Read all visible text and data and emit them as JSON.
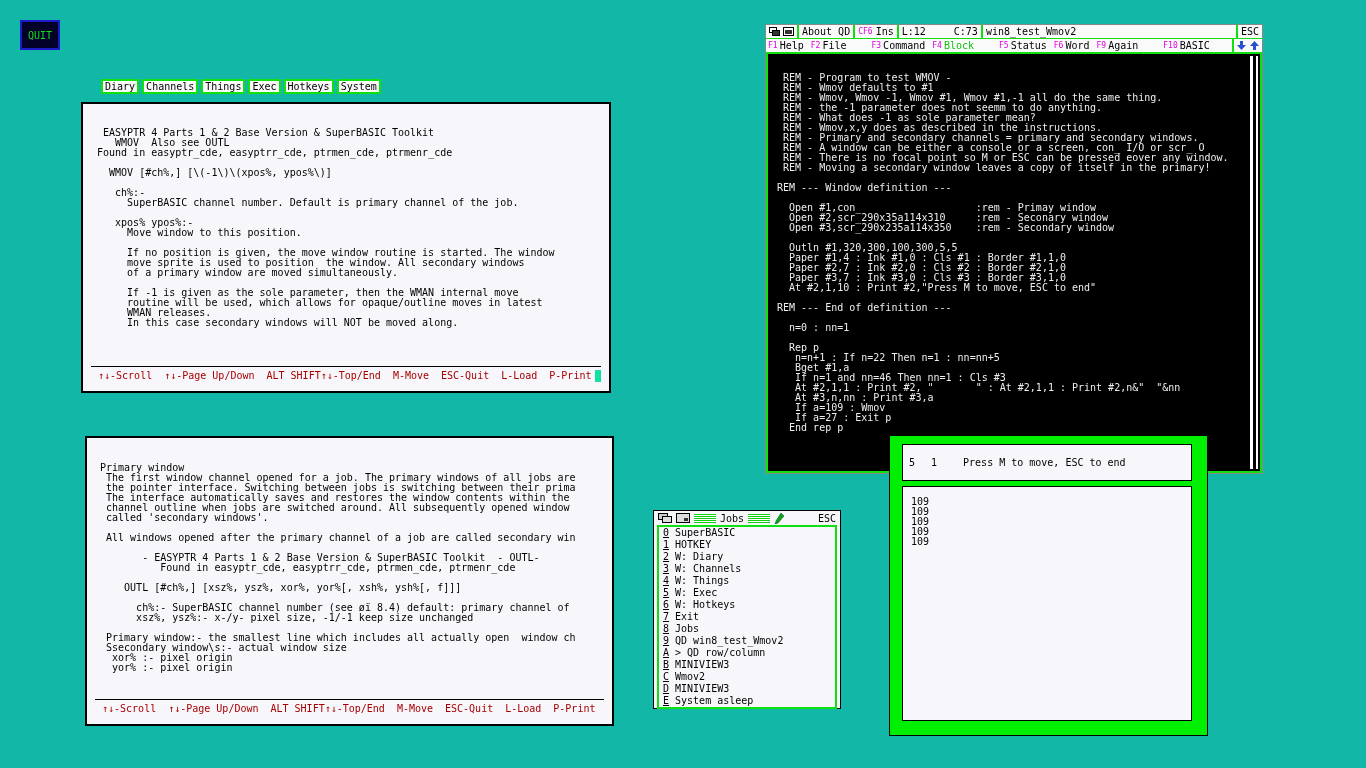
{
  "quit_button": {
    "label": "QUIT"
  },
  "menu": [
    "Diary",
    "Channels",
    "Things",
    "Exec",
    "Hotkeys",
    "System"
  ],
  "help_windows": [
    {
      "cursor": true,
      "blocks": [
        [
          " EASYPTR 4 Parts 1 & 2 Base Version & SuperBASIC Toolkit",
          "   WMOV  Also see OUTL",
          "Found in easyptr_cde, easyptrr_cde, ptrmen_cde, ptrmenr_cde"
        ],
        [
          "  WMOV [#ch%,] [\\(-1\\)\\(xpos%, ypos%\\)]"
        ],
        [
          "   ch%:-",
          "     SuperBASIC channel number. Default is primary channel of the job."
        ],
        [
          "   xpos% ypos%:-",
          "     Move window to this position."
        ],
        [
          "     If no position is given, the move window routine is started. The window",
          "     move sprite is used to position  the window. All secondary windows",
          "     of a primary window are moved simultaneously."
        ],
        [
          "     If -1 is given as the sole parameter, then the WMAN internal move",
          "     routine will be used, which allows for opaque/outline moves in latest",
          "     WMAN releases.",
          "     In this case secondary windows will NOT be moved along."
        ]
      ],
      "footer": [
        "↑↓-Scroll",
        "↑↓-Page Up/Down",
        "ALT SHIFT↑↓-Top/End",
        "M-Move",
        "ESC-Quit",
        "L-Load",
        "P-Print"
      ]
    },
    {
      "cursor": false,
      "blocks": [
        [
          "Primary window",
          " The first window channel opened for a job. The primary windows of all jobs are",
          " the pointer interface. Switching between jobs is switching between their prima",
          " The interface automatically saves and restores the window contents within the",
          " channel outline when jobs are switched around. All subsequently opened window",
          " called 'secondary windows'."
        ],
        [
          " All windows opened after the primary channel of a job are called secondary win"
        ],
        [
          "       - EASYPTR 4 Parts 1 & 2 Base Version & SuperBASIC Toolkit  - OUTL-",
          "          Found in easyptr_cde, easyptrr_cde, ptrmen_cde, ptrmenr_cde"
        ],
        [
          "    OUTL [#ch%,] [xsz%, ysz%, xor%, yor%[, xsh%, ysh%[, f]]]"
        ],
        [
          "      ch%:- SuperBASIC channel number (see øï 8.4) default: primary channel of",
          "      xsz%, ysz%:- x-/y- pixel size, -1/-1 keep size unchanged"
        ],
        [
          " Primary window:- the smallest line which includes all actually open  window ch",
          " Ssecondary window\\s:- actual window size",
          "  xor% :- pixel origin",
          "  yor% :- pixel origin"
        ]
      ],
      "footer": [
        "↑↓-Scroll",
        "↑↓-Page Up/Down",
        "ALT SHIFT↑↓-Top/End",
        "M-Move",
        "ESC-Quit",
        "L-Load",
        "P-Print"
      ]
    }
  ],
  "editor": {
    "toolbar": {
      "about": "About QD",
      "insert_key": "CF6",
      "insert_mode": "Ins",
      "line": "L:12",
      "column": "C:73",
      "filename": "win8_test_Wmov2",
      "escape": "ESC"
    },
    "function_keys": [
      {
        "key": "F1",
        "label": "Help",
        "active": false
      },
      {
        "key": "F2",
        "label": "File",
        "active": false
      },
      {
        "key": "F3",
        "label": "Command",
        "active": false
      },
      {
        "key": "F4",
        "label": "Block",
        "active": true
      },
      {
        "key": "F5",
        "label": "Status",
        "active": false
      },
      {
        "key": "F6",
        "label": "Word",
        "active": false
      },
      {
        "key": "F9",
        "label": "Again",
        "active": false
      },
      {
        "key": "F10",
        "label": "BASIC",
        "active": false
      }
    ],
    "blocks": [
      [
        " REM - Program to test WMOV -",
        " REM - Wmov defaults to #1",
        " REM - Wmov, Wmov -1, Wmov #1, Wmov #1,-1 all do the same thing.",
        " REM - the -1 parameter does not seemm to do anything.",
        " REM - What does -1 as sole parameter mean?",
        " REM - Wmov,x,y does as described in the instructions.",
        " REM - Primary and secondary channels = primary and secondary windows.",
        " REM - A window can be either a console or a screen, con_ I/O or scr_ O",
        " REM - There is no focal point so M or ESC can be pressed eover any window.",
        " REM - Moving a secondary window leaves a copy of itself in the primary!"
      ],
      [
        "REM --- Window definition ---"
      ],
      [
        "  Open #1,con_                   :rem - Primay window",
        "  Open #2,scr_290x35a114x310     :rem - Seconary window",
        "  Open #3,scr_290x235a114x350    :rem - Secondary window"
      ],
      [
        "  Outln #1,320,300,100,300,5,5",
        "  Paper #1,4 : Ink #1,0 : Cls #1 : Border #1,1,0",
        "  Paper #2,7 : Ink #2,0 : Cls #2 : Border #2,1,0",
        "  Paper #3,7 : Ink #3,0 : Cls #3 : Border #3,1,0",
        "  At #2,1,10 : Print #2,\"Press M to move, ESC to end\""
      ],
      [
        "REM --- End of definition ---"
      ],
      [
        "  n=0 : nn=1"
      ],
      [
        "  Rep p",
        "   n=n+1 : If n=22 Then n=1 : nn=nn+5",
        "   Bget #1,a",
        "   If n=1 and nn=46 Then nn=1 : Cls #3",
        "   At #2,1,1 : Print #2, \"       \" : At #2,1,1 : Print #2,n&\"  \"&nn",
        "   At #3,n,nn : Print #3,a",
        "   If a=109 : Wmov",
        "   If a=27 : Exit p",
        "  End rep p"
      ]
    ]
  },
  "jobs": {
    "title": "Jobs",
    "escape": "ESC",
    "items": [
      {
        "key": "0",
        "label": "SuperBASIC"
      },
      {
        "key": "1",
        "label": "HOTKEY"
      },
      {
        "key": "2",
        "label": "W: Diary"
      },
      {
        "key": "3",
        "label": "W: Channels"
      },
      {
        "key": "4",
        "label": "W: Things"
      },
      {
        "key": "5",
        "label": "W: Exec"
      },
      {
        "key": "6",
        "label": "W: Hotkeys"
      },
      {
        "key": "7",
        "label": "Exit"
      },
      {
        "key": "8",
        "label": "Jobs"
      },
      {
        "key": "9",
        "label": "QD win8_test_Wmov2"
      },
      {
        "key": "A",
        "label": "> QD row/column"
      },
      {
        "key": "B",
        "label": "MINIVIEW3"
      },
      {
        "key": "C",
        "label": "Wmov2"
      },
      {
        "key": "D",
        "label": "MINIVIEW3"
      },
      {
        "key": "E",
        "label": "System asleep"
      }
    ]
  },
  "output_window": {
    "counters": [
      "5",
      "1"
    ],
    "message": "Press M to move, ESC to end",
    "values": [
      "109",
      "109",
      "109",
      "109",
      "109"
    ]
  }
}
